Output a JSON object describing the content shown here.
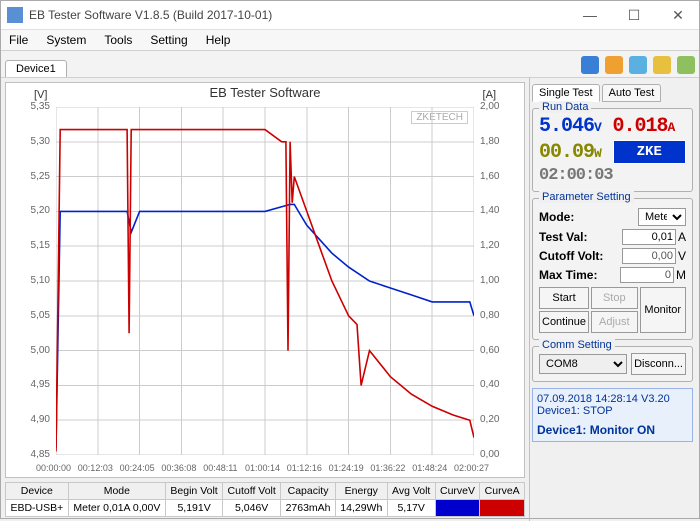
{
  "window": {
    "title": "EB Tester Software V1.8.5 (Build 2017-10-01)"
  },
  "menu": [
    "File",
    "System",
    "Tools",
    "Setting",
    "Help"
  ],
  "device_tab": "Device1",
  "chart_data": {
    "type": "line",
    "title": "EB Tester Software",
    "xlabel": "",
    "left_axis_label": "[V]",
    "right_axis_label": "[A]",
    "watermark": "ZKETECH",
    "x_ticks": [
      "00:00:00",
      "00:12:03",
      "00:24:05",
      "00:36:08",
      "00:48:11",
      "01:00:14",
      "01:12:16",
      "01:24:19",
      "01:36:22",
      "01:48:24",
      "02:00:27"
    ],
    "left_axis": {
      "min": 4.85,
      "max": 5.35,
      "ticks": [
        4.85,
        4.9,
        4.95,
        5.0,
        5.05,
        5.1,
        5.15,
        5.2,
        5.25,
        5.3,
        5.35
      ]
    },
    "right_axis": {
      "min": 0.0,
      "max": 2.0,
      "ticks": [
        0.0,
        0.2,
        0.4,
        0.6,
        0.8,
        1.0,
        1.2,
        1.4,
        1.6,
        1.8,
        2.0
      ]
    },
    "series": [
      {
        "name": "Voltage",
        "axis": "left",
        "color": "#0022cc",
        "x": [
          0.0,
          0.01,
          0.02,
          0.05,
          0.1,
          0.15,
          0.17,
          0.18,
          0.2,
          0.3,
          0.4,
          0.5,
          0.56,
          0.57,
          0.58,
          0.6,
          0.63,
          0.66,
          0.7,
          0.75,
          0.8,
          0.85,
          0.9,
          0.95,
          0.99,
          1.0
        ],
        "y": [
          4.86,
          5.2,
          5.2,
          5.2,
          5.2,
          5.2,
          5.2,
          5.17,
          5.2,
          5.2,
          5.2,
          5.2,
          5.21,
          5.21,
          5.2,
          5.18,
          5.16,
          5.14,
          5.12,
          5.1,
          5.09,
          5.08,
          5.07,
          5.07,
          5.07,
          5.05
        ]
      },
      {
        "name": "Current",
        "axis": "right",
        "color": "#cc0000",
        "x": [
          0.0,
          0.01,
          0.02,
          0.05,
          0.1,
          0.15,
          0.17,
          0.175,
          0.18,
          0.2,
          0.3,
          0.4,
          0.5,
          0.54,
          0.55,
          0.555,
          0.56,
          0.565,
          0.57,
          0.6,
          0.63,
          0.66,
          0.7,
          0.72,
          0.73,
          0.75,
          0.8,
          0.85,
          0.9,
          0.95,
          0.99,
          1.0
        ],
        "y": [
          0.02,
          1.87,
          1.87,
          1.87,
          1.87,
          1.87,
          1.87,
          0.7,
          1.87,
          1.87,
          1.87,
          1.87,
          1.87,
          1.8,
          1.8,
          0.6,
          1.8,
          1.45,
          1.6,
          1.4,
          1.2,
          1.0,
          0.8,
          0.75,
          0.4,
          0.6,
          0.45,
          0.35,
          0.28,
          0.23,
          0.2,
          0.1
        ]
      }
    ]
  },
  "table": {
    "headers": [
      "Device",
      "Mode",
      "Begin Volt",
      "Cutoff Volt",
      "Capacity",
      "Energy",
      "Avg Volt",
      "CurveV",
      "CurveA"
    ],
    "row": {
      "device": "EBD-USB+",
      "mode": "Meter 0,01A 0,00V",
      "begin_volt": "5,191V",
      "cutoff_volt": "5,046V",
      "capacity": "2763mAh",
      "energy": "14,29Wh",
      "avg_volt": "5,17V"
    }
  },
  "right_panel": {
    "tabs": [
      "Single Test",
      "Auto Test"
    ],
    "run_data": {
      "title": "Run Data",
      "voltage": "5.046",
      "voltage_unit": "V",
      "current": "0.018",
      "current_unit": "A",
      "power": "00.09",
      "power_unit": "W",
      "time": "02:00:03",
      "logo": "ZKE"
    },
    "param": {
      "title": "Parameter Setting",
      "mode_label": "Mode:",
      "mode_value": "Meter",
      "testval_label": "Test Val:",
      "testval_value": "0,01",
      "testval_unit": "A",
      "cutoff_label": "Cutoff Volt:",
      "cutoff_value": "0,00",
      "cutoff_unit": "V",
      "maxtime_label": "Max Time:",
      "maxtime_value": "0",
      "maxtime_unit": "M",
      "btn_start": "Start",
      "btn_stop": "Stop",
      "btn_monitor": "Monitor",
      "btn_continue": "Continue",
      "btn_adjust": "Adjust"
    },
    "comm": {
      "title": "Comm Setting",
      "port": "COM8",
      "btn_disconnect": "Disconn..."
    },
    "status": {
      "line1a": "07.09.2018 14:28:14 V3.20",
      "line1b": "Device1: STOP",
      "line2": "Device1: Monitor ON"
    }
  }
}
